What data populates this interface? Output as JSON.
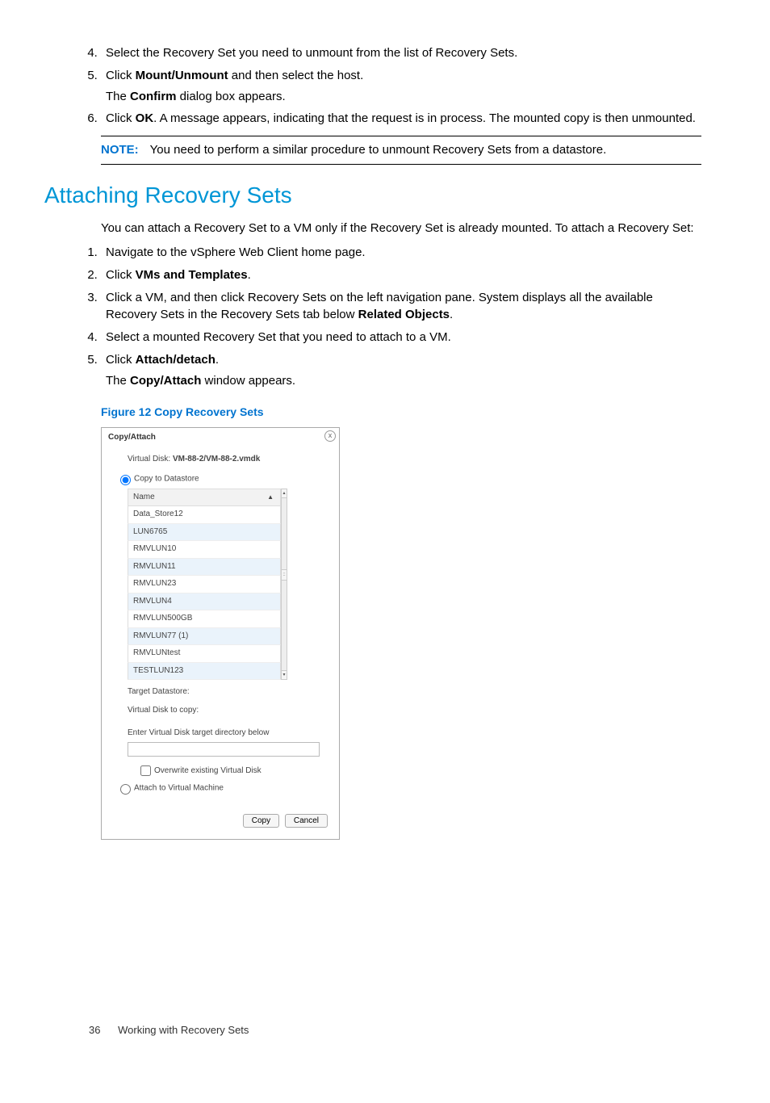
{
  "topSteps": [
    {
      "num": "4.",
      "text_a": "Select the Recovery Set you need to unmount from the list of Recovery Sets."
    },
    {
      "num": "5.",
      "text_a": "Click ",
      "bold_a": "Mount/Unmount",
      "text_b": " and then select the host.",
      "para_a": "The ",
      "para_bold": "Confirm",
      "para_b": " dialog box appears."
    },
    {
      "num": "6.",
      "text_a": "Click ",
      "bold_a": "OK",
      "text_b": ". A message appears, indicating that the request is in process. The mounted copy is then unmounted."
    }
  ],
  "note": {
    "label": "NOTE:",
    "text": "You need to perform a similar procedure to unmount Recovery Sets from a datastore."
  },
  "section": {
    "title": "Attaching Recovery Sets",
    "intro": "You can attach a Recovery Set to a VM only if the Recovery Set is already mounted. To attach a Recovery Set:",
    "steps": [
      {
        "num": "1.",
        "text_a": "Navigate to the vSphere Web Client home page."
      },
      {
        "num": "2.",
        "text_a": "Click ",
        "bold_a": "VMs and Templates",
        "text_b": "."
      },
      {
        "num": "3.",
        "text_a": "Click a VM, and then click Recovery Sets on the left navigation pane. System displays all the available Recovery Sets in the Recovery Sets tab below ",
        "bold_a": "Related Objects",
        "text_b": "."
      },
      {
        "num": "4.",
        "text_a": "Select a mounted Recovery Set that you need to attach to a VM."
      },
      {
        "num": "5.",
        "text_a": "Click ",
        "bold_a": "Attach/detach",
        "text_b": ".",
        "para_a": "The ",
        "para_bold": "Copy/Attach",
        "para_b": " window appears."
      }
    ]
  },
  "figure": {
    "caption": "Figure 12 Copy Recovery Sets"
  },
  "dialog": {
    "title": "Copy/Attach",
    "close": "x",
    "vdisk_label": "Virtual Disk: ",
    "vdisk_value": "VM-88-2/VM-88-2.vmdk",
    "radio_copy": "Copy to Datastore",
    "list_header": "Name",
    "sort_arrow": "▲",
    "rows": [
      "Data_Store12",
      "LUN6765",
      "RMVLUN10",
      "RMVLUN11",
      "RMVLUN23",
      "RMVLUN4",
      "RMVLUN500GB",
      "RMVLUN77 (1)",
      "RMVLUNtest",
      "TESTLUN123"
    ],
    "target_ds": "Target Datastore:",
    "vd_to_copy": "Virtual Disk to copy:",
    "enter_dir": "Enter Virtual Disk target directory below",
    "overwrite": "Overwrite existing Virtual Disk",
    "radio_attach": "Attach to Virtual Machine",
    "btn_copy": "Copy",
    "btn_cancel": "Cancel"
  },
  "footer": {
    "page": "36",
    "section": "Working with Recovery Sets"
  }
}
